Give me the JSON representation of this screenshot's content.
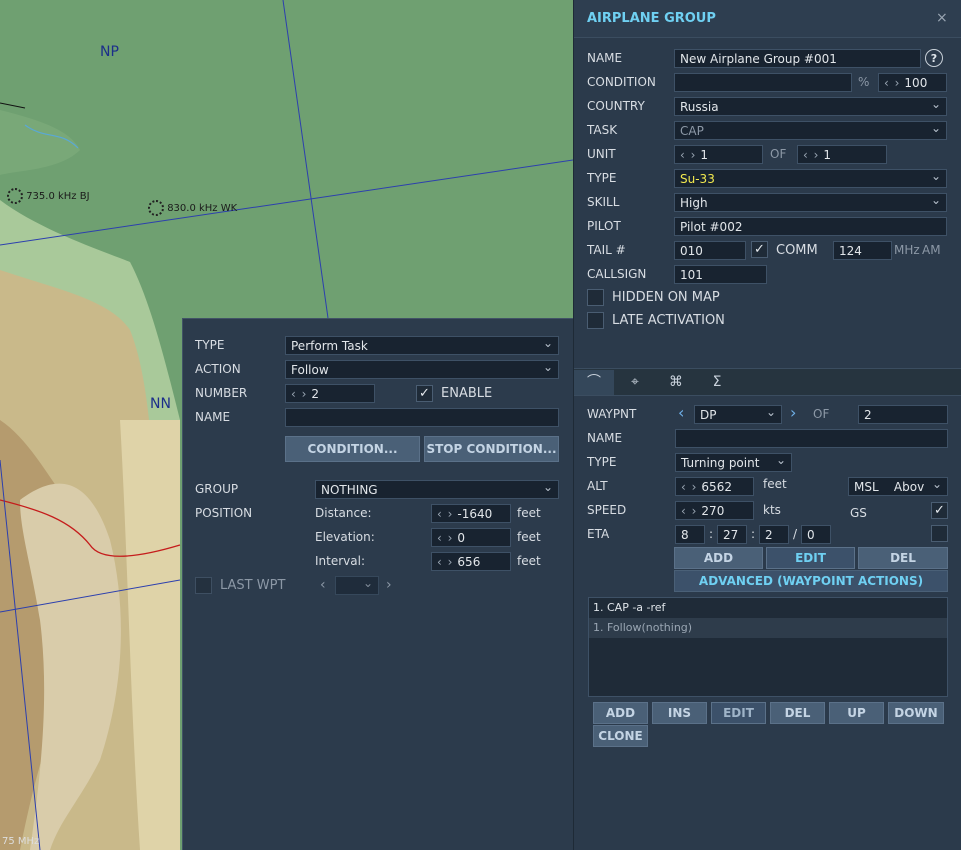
{
  "map": {
    "labels": [
      "NP",
      "NN"
    ],
    "navaids": [
      "735.0 kHz BJ",
      "830.0 kHz WK"
    ],
    "corner_text": "75 MHz"
  },
  "group_panel": {
    "title": "AIRPLANE GROUP",
    "close_icon": "×",
    "name_label": "NAME",
    "name_value": "New Airplane Group #001",
    "help": "?",
    "condition_label": "CONDITION",
    "condition_value": "",
    "percent": "%",
    "condition_spin": "100",
    "country_label": "COUNTRY",
    "country_value": "Russia",
    "task_label": "TASK",
    "task_value": "CAP",
    "unit_label": "UNIT",
    "unit_value": "1",
    "of_label": "OF",
    "unit_total": "1",
    "type_label": "TYPE",
    "type_value": "Su-33",
    "skill_label": "SKILL",
    "skill_value": "High",
    "pilot_label": "PILOT",
    "pilot_value": "Pilot #002",
    "tail_label": "TAIL #",
    "tail_value": "010",
    "comm_label": "COMM",
    "comm_value": "124",
    "comm_unit": "MHz",
    "comm_mode": "AM",
    "callsign_label": "CALLSIGN",
    "callsign_value": "101",
    "hidden_label": "HIDDEN ON MAP",
    "late_label": "LATE ACTIVATION"
  },
  "tabs": [
    "route-icon",
    "target-icon",
    "command-icon",
    "sigma-icon"
  ],
  "tab_glyphs": [
    "⌒",
    "⌖",
    "⌘",
    "Σ"
  ],
  "waypoint": {
    "label": "WAYPNT",
    "value": "DP",
    "of_label": "OF",
    "total": "2",
    "name_label": "NAME",
    "name_value": "",
    "type_label": "TYPE",
    "type_value": "Turning point",
    "alt_label": "ALT",
    "alt_value": "6562",
    "alt_unit": "feet",
    "alt_ref": "MSL",
    "alt_ref2": "Abov",
    "speed_label": "SPEED",
    "speed_value": "270",
    "speed_unit": "kts",
    "gs_label": "GS",
    "eta_label": "ETA",
    "eta_d": "8",
    "eta_h": "27",
    "eta_m": "2",
    "eta_s": "0",
    "add": "ADD",
    "edit": "EDIT",
    "del": "DEL",
    "advanced": "ADVANCED (WAYPOINT ACTIONS)"
  },
  "actions_list": {
    "items": [
      "1. CAP -a -ref",
      "1. Follow(nothing)"
    ],
    "buttons": [
      "ADD",
      "INS",
      "EDIT",
      "DEL",
      "UP",
      "DOWN",
      "CLONE"
    ]
  },
  "action_panel": {
    "type_label": "TYPE",
    "type_value": "Perform Task",
    "action_label": "ACTION",
    "action_value": "Follow",
    "number_label": "NUMBER",
    "number_value": "2",
    "enable_label": "ENABLE",
    "name_label": "NAME",
    "name_value": "",
    "condition_btn": "CONDITION...",
    "stop_condition_btn": "STOP CONDITION...",
    "group_label": "GROUP",
    "group_value": "NOTHING",
    "position_label": "POSITION",
    "distance_label": "Distance:",
    "distance_value": "-1640",
    "elevation_label": "Elevation:",
    "elevation_value": "0",
    "interval_label": "Interval:",
    "interval_value": "656",
    "unit": "feet",
    "last_wpt_label": "LAST WPT"
  },
  "colors": {
    "panel": "#2b3a4b",
    "title": "#6fd0f2",
    "accent_type": "#f2e94e",
    "map_green": "#6fa071"
  }
}
